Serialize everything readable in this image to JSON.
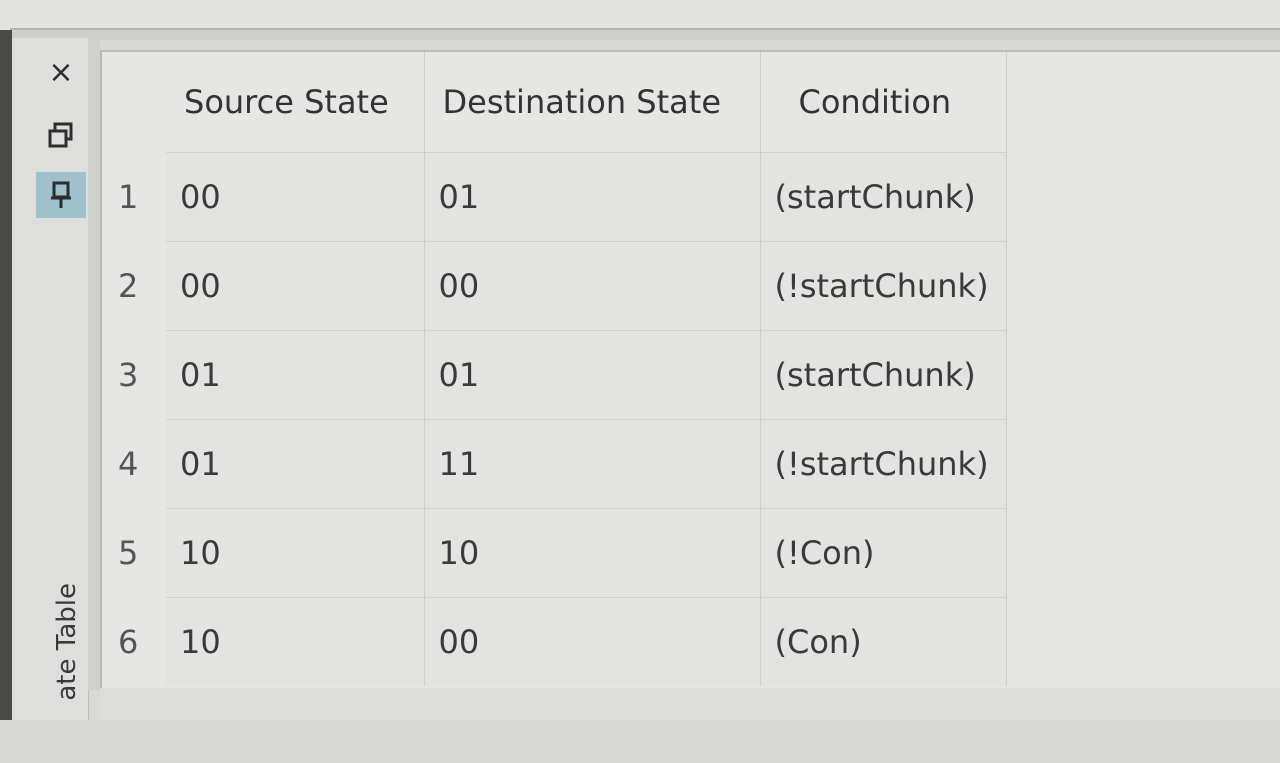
{
  "panel": {
    "tab_label": "ate Table",
    "close_icon": "×",
    "restore_icon": "restore-window-icon",
    "pin_icon": "pin-icon"
  },
  "table": {
    "columns": [
      "Source State",
      "Destination State",
      "Condition"
    ],
    "rows": [
      {
        "num": "1",
        "source": "00",
        "dest": "01",
        "cond": "(startChunk)"
      },
      {
        "num": "2",
        "source": "00",
        "dest": "00",
        "cond": "(!startChunk)"
      },
      {
        "num": "3",
        "source": "01",
        "dest": "01",
        "cond": "(startChunk)"
      },
      {
        "num": "4",
        "source": "01",
        "dest": "11",
        "cond": "(!startChunk)"
      },
      {
        "num": "5",
        "source": "10",
        "dest": "10",
        "cond": "(!Con)"
      },
      {
        "num": "6",
        "source": "10",
        "dest": "00",
        "cond": "(Con)"
      }
    ]
  },
  "colors": {
    "active_button": "#9fc1cc",
    "table_bg": "#e6e6e4"
  }
}
